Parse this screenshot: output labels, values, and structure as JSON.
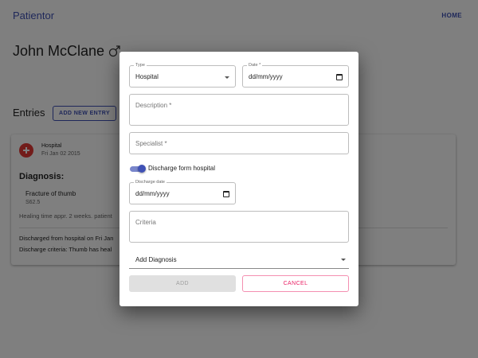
{
  "app": {
    "brand": "Patientor",
    "nav_home": "HOME"
  },
  "patient": {
    "name": "John McClane",
    "gender_icon": "male-symbol-icon"
  },
  "entries": {
    "title": "Entries",
    "add_button": "ADD NEW ENTRY",
    "entry": {
      "icon": "hospital-icon",
      "type": "Hospital",
      "date": "Fri Jan 02 2015",
      "diagnosis_heading": "Diagnosis:",
      "diagnosis_name": "Fracture of thumb",
      "diagnosis_code": "S62.5",
      "healing_text": "Healing time appr. 2 weeks. patient",
      "discharged_text": "Discharged from hospital on Fri Jan",
      "criteria_text": "Discharge criteria: Thumb has heal"
    }
  },
  "dialog": {
    "type": {
      "label": "Type",
      "value": "Hospital"
    },
    "date": {
      "label": "Date *",
      "value": "dd/mm/yyyy"
    },
    "description": {
      "placeholder": "Description *"
    },
    "specialist": {
      "placeholder": "Specialist *"
    },
    "discharge_toggle": {
      "label": "Discharge form hospital",
      "checked": true
    },
    "discharge_date": {
      "label": "Discharge date",
      "value": "dd/mm/yyyy"
    },
    "criteria": {
      "placeholder": "Criteria"
    },
    "add_diagnosis": {
      "placeholder": "Add Diagnosis"
    },
    "add_button": "ADD",
    "cancel_button": "CANCEL"
  },
  "colors": {
    "primary": "#3f51b5",
    "hospital_icon": "#e53935",
    "cancel": "#e91e63",
    "backdrop": "rgba(0,0,0,0.5)"
  }
}
